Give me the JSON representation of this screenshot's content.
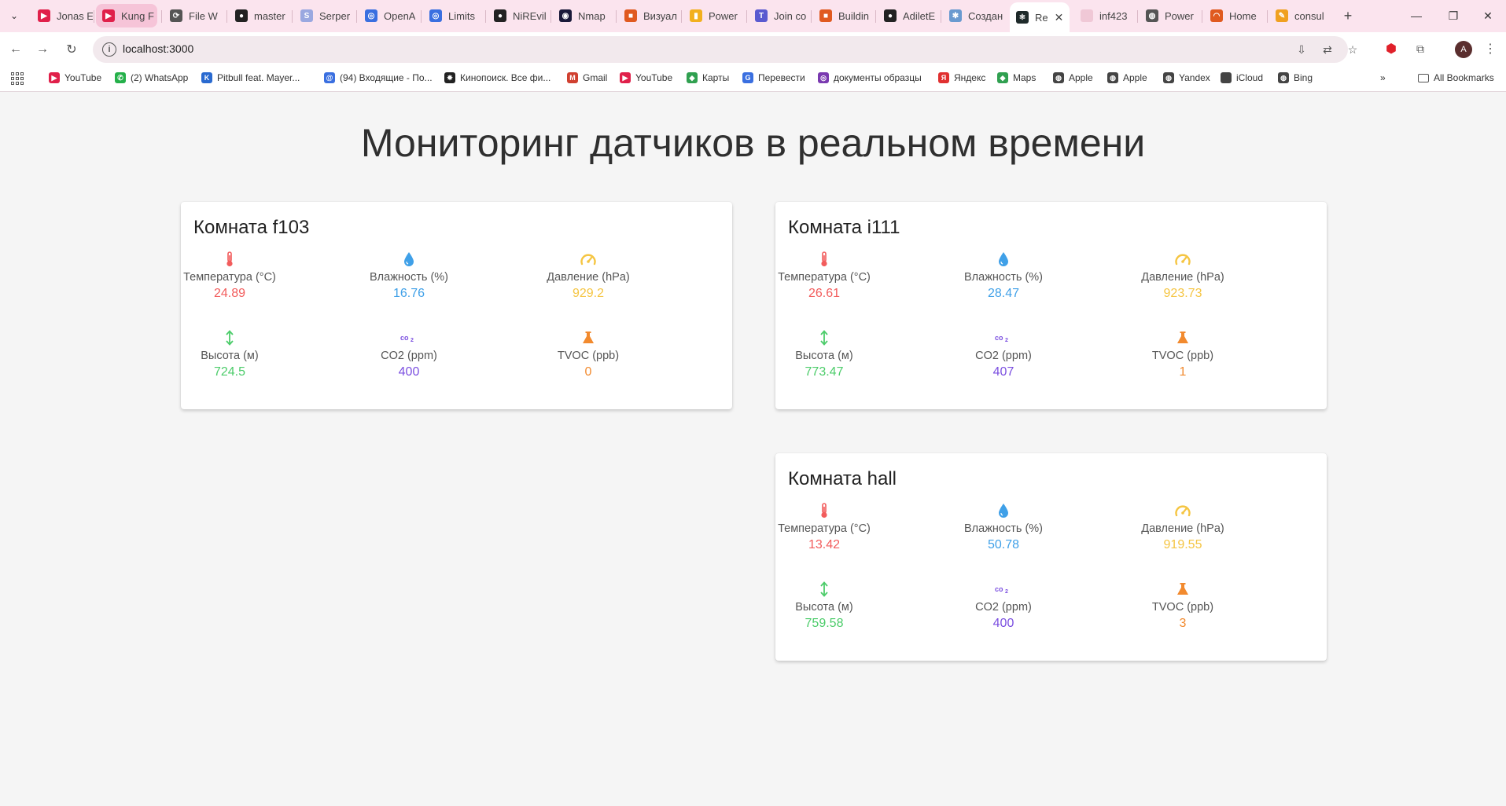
{
  "browser": {
    "tabs": [
      {
        "title": "Jonas E",
        "color": "#e0204a",
        "glyph": "▶"
      },
      {
        "title": "Kung F",
        "color": "#e0204a",
        "glyph": "▶"
      },
      {
        "title": "File W",
        "color": "#555555",
        "glyph": "⟳"
      },
      {
        "title": "master",
        "color": "#222222",
        "glyph": "●"
      },
      {
        "title": "Serper",
        "color": "#9aa8e0",
        "glyph": "S"
      },
      {
        "title": "OpenA",
        "color": "#3a6fe0",
        "glyph": "◎"
      },
      {
        "title": "Limits",
        "color": "#3a6fe0",
        "glyph": "◎"
      },
      {
        "title": "NiREvil",
        "color": "#222222",
        "glyph": "●"
      },
      {
        "title": "Nmap",
        "color": "#1a1a3a",
        "glyph": "◉"
      },
      {
        "title": "Визуал",
        "color": "#e05a20",
        "glyph": "■"
      },
      {
        "title": "Power",
        "color": "#f2b01e",
        "glyph": "▮"
      },
      {
        "title": "Join co",
        "color": "#5a5ad0",
        "glyph": "T"
      },
      {
        "title": "Buildin",
        "color": "#e05a20",
        "glyph": "■"
      },
      {
        "title": "AdiletE",
        "color": "#222222",
        "glyph": "●"
      },
      {
        "title": "Создан",
        "color": "#6a9ad0",
        "glyph": "✱"
      },
      {
        "title": "Re",
        "color": "#1e2a2a",
        "glyph": "⚛"
      },
      {
        "title": "inf423",
        "color": "#f0c8d6",
        "glyph": ""
      },
      {
        "title": "Power",
        "color": "#555555",
        "glyph": "◍"
      },
      {
        "title": "Home",
        "color": "#e05a20",
        "glyph": "◠"
      },
      {
        "title": "consul",
        "color": "#f0a020",
        "glyph": "✎"
      }
    ],
    "url": "localhost:3000",
    "bookmarks": [
      {
        "label": "YouTube",
        "color": "#e0204a",
        "glyph": "▶"
      },
      {
        "label": "(2) WhatsApp",
        "color": "#25b04a",
        "glyph": "✆"
      },
      {
        "label": "Pitbull feat. Mayer...",
        "color": "#2a6ad0",
        "glyph": "K"
      },
      {
        "label": "(94) Входящие - По...",
        "color": "#3a6fe0",
        "glyph": "@"
      },
      {
        "label": "Кинопоиск. Все фи...",
        "color": "#222222",
        "glyph": "✸"
      },
      {
        "label": "Gmail",
        "color": "#d04030",
        "glyph": "M"
      },
      {
        "label": "YouTube",
        "color": "#e0204a",
        "glyph": "▶"
      },
      {
        "label": "Карты",
        "color": "#30a050",
        "glyph": "◆"
      },
      {
        "label": "Перевести",
        "color": "#3a6fe0",
        "glyph": "G"
      },
      {
        "label": "документы образцы",
        "color": "#7a3ab0",
        "glyph": "◎"
      },
      {
        "label": "Яндекс",
        "color": "#e03030",
        "glyph": "Я"
      },
      {
        "label": "Maps",
        "color": "#30a050",
        "glyph": "◆"
      },
      {
        "label": "Apple",
        "color": "#444444",
        "glyph": "◍"
      },
      {
        "label": "Apple",
        "color": "#444444",
        "glyph": "◍"
      },
      {
        "label": "Yandex",
        "color": "#444444",
        "glyph": "◍"
      },
      {
        "label": "iCloud",
        "color": "#444444",
        "glyph": ""
      },
      {
        "label": "Bing",
        "color": "#444444",
        "glyph": "◍"
      }
    ],
    "all_bookmarks_label": "All Bookmarks",
    "profile_initial": "A"
  },
  "page": {
    "title": "Мониторинг датчиков в реальном времени"
  },
  "rooms": [
    {
      "title": "Комната f103",
      "metrics": [
        {
          "icon": "thermometer-icon",
          "label": "Температура (°C)",
          "value": "24.89",
          "color": "#f25c5c"
        },
        {
          "icon": "droplet-icon",
          "label": "Влажность (%)",
          "value": "16.76",
          "color": "#3fa0e8"
        },
        {
          "icon": "gauge-icon",
          "label": "Давление (hPa)",
          "value": "929.2",
          "color": "#f5c542"
        },
        {
          "icon": "altitude-arrows-icon",
          "label": "Высота (м)",
          "value": "724.5",
          "color": "#4ccc6a"
        },
        {
          "icon": "co2-icon",
          "label": "CO2 (ppm)",
          "value": "400",
          "color": "#7b4fe0"
        },
        {
          "icon": "flask-icon",
          "label": "TVOC (ppb)",
          "value": "0",
          "color": "#f28a2e"
        }
      ]
    },
    {
      "title": "Комната i111",
      "metrics": [
        {
          "icon": "thermometer-icon",
          "label": "Температура (°C)",
          "value": "26.61",
          "color": "#f25c5c"
        },
        {
          "icon": "droplet-icon",
          "label": "Влажность (%)",
          "value": "28.47",
          "color": "#3fa0e8"
        },
        {
          "icon": "gauge-icon",
          "label": "Давление (hPa)",
          "value": "923.73",
          "color": "#f5c542"
        },
        {
          "icon": "altitude-arrows-icon",
          "label": "Высота (м)",
          "value": "773.47",
          "color": "#4ccc6a"
        },
        {
          "icon": "co2-icon",
          "label": "CO2 (ppm)",
          "value": "407",
          "color": "#7b4fe0"
        },
        {
          "icon": "flask-icon",
          "label": "TVOC (ppb)",
          "value": "1",
          "color": "#f28a2e"
        }
      ]
    },
    {
      "title": "Комната hall",
      "metrics": [
        {
          "icon": "thermometer-icon",
          "label": "Температура (°C)",
          "value": "13.42",
          "color": "#f25c5c"
        },
        {
          "icon": "droplet-icon",
          "label": "Влажность (%)",
          "value": "50.78",
          "color": "#3fa0e8"
        },
        {
          "icon": "gauge-icon",
          "label": "Давление (hPa)",
          "value": "919.55",
          "color": "#f5c542"
        },
        {
          "icon": "altitude-arrows-icon",
          "label": "Высота (м)",
          "value": "759.58",
          "color": "#4ccc6a"
        },
        {
          "icon": "co2-icon",
          "label": "CO2 (ppm)",
          "value": "400",
          "color": "#7b4fe0"
        },
        {
          "icon": "flask-icon",
          "label": "TVOC (ppb)",
          "value": "3",
          "color": "#f28a2e"
        }
      ]
    }
  ]
}
